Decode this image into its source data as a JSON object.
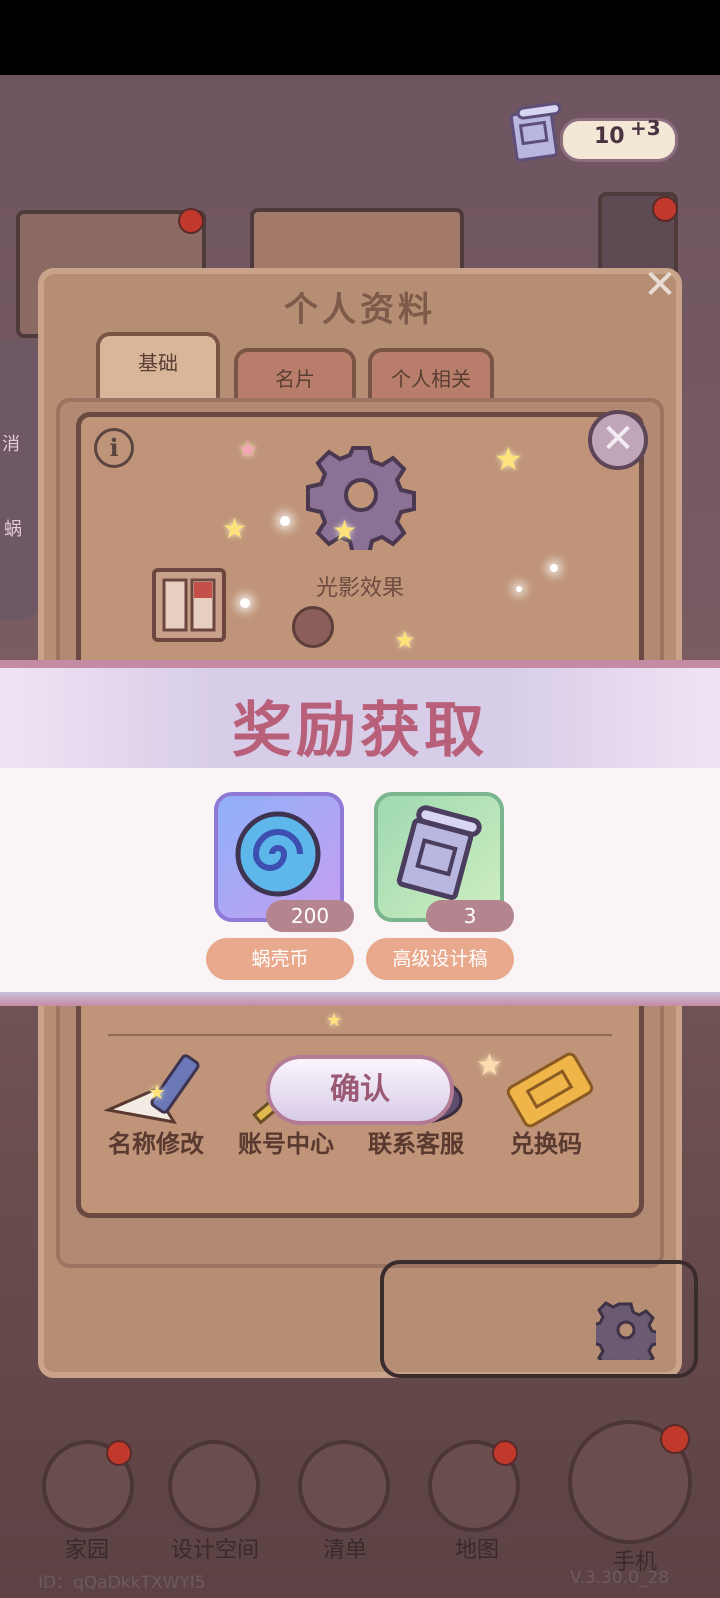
{
  "currency": {
    "value": "10",
    "plus": "+3",
    "icon": "blueprint-scroll-icon"
  },
  "panel": {
    "title": "个人资料",
    "tabs": [
      {
        "label": "基础"
      },
      {
        "label": "名片"
      },
      {
        "label": "个人相关"
      }
    ],
    "settings": {
      "light_label": "光影效果"
    },
    "functions": [
      {
        "label": "名称修改",
        "icon": "pencil-icon"
      },
      {
        "label": "账号中心",
        "icon": "key-icon"
      },
      {
        "label": "联系客服",
        "icon": "support-icon"
      },
      {
        "label": "兑换码",
        "icon": "ticket-icon"
      }
    ]
  },
  "reward": {
    "title": "奖励获取",
    "items": [
      {
        "name": "蜗壳币",
        "count": "200",
        "icon": "snail-shell-coin-icon"
      },
      {
        "name": "高级设计稿",
        "count": "3",
        "icon": "blueprint-scroll-icon"
      }
    ],
    "confirm_label": "确认"
  },
  "nav": [
    {
      "label": "家园",
      "icon": "home-icon"
    },
    {
      "label": "设计空间",
      "icon": "design-icon"
    },
    {
      "label": "清单",
      "icon": "list-icon"
    },
    {
      "label": "地图",
      "icon": "map-pin-icon"
    },
    {
      "label": "手机",
      "icon": "phone-icon"
    }
  ],
  "side": {
    "label1": "消",
    "label2": "蜗"
  },
  "footer": {
    "id": "ID：qQaDkkTXWYI5",
    "version": "V.3.30.0_28"
  },
  "colors": {
    "accent": "#b8607a",
    "banner": "#d8cde9",
    "pill": "#e8a98d"
  }
}
